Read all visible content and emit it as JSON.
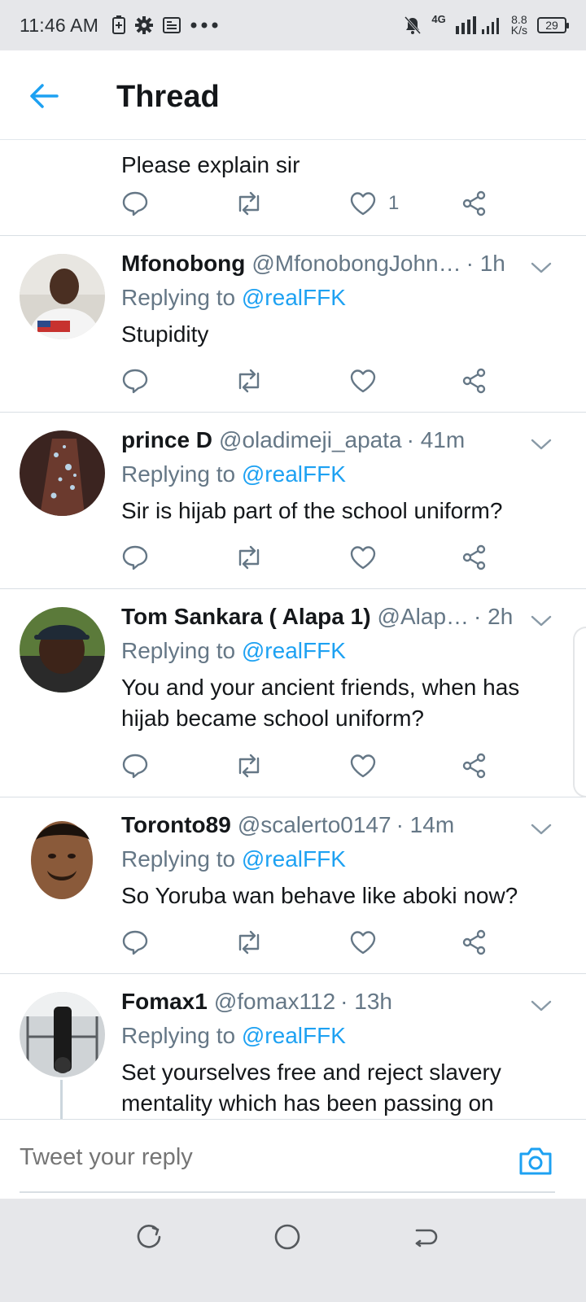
{
  "status_bar": {
    "time": "11:46 AM",
    "network": "4G",
    "speed_value": "8.8",
    "speed_unit": "K/s",
    "battery": "29"
  },
  "header": {
    "title": "Thread"
  },
  "tweets": [
    {
      "body": "Please explain sir",
      "like_count": "1"
    },
    {
      "name": "Mfonobong",
      "handle": "@MfonobongJohn…",
      "time": "· 1h",
      "replying_prefix": "Replying to",
      "replying_to": "@realFFK",
      "body": "Stupidity"
    },
    {
      "name": "prince D",
      "handle": "@oladimeji_apata",
      "time": "· 41m",
      "replying_prefix": "Replying to",
      "replying_to": "@realFFK",
      "body": "Sir is hijab part of the school uniform?"
    },
    {
      "name": "Tom Sankara ( Alapa 1)",
      "handle": "@Alap…",
      "time": "· 2h",
      "replying_prefix": "Replying to",
      "replying_to": "@realFFK",
      "body": "You and your ancient friends,  when has hijab became school uniform?"
    },
    {
      "name": "Toronto89",
      "handle": "@scalerto0147",
      "time": "· 14m",
      "replying_prefix": "Replying to",
      "replying_to": "@realFFK",
      "body": "So Yoruba wan behave like aboki now?"
    },
    {
      "name": "Fomax1",
      "handle": "@fomax112",
      "time": "· 13h",
      "replying_prefix": "Replying to",
      "replying_to": "@realFFK",
      "body": "Set yourselves free and reject slavery mentality which has been passing on"
    }
  ],
  "reply_bar": {
    "placeholder": "Tweet your reply"
  },
  "colors": {
    "accent": "#1da1f2",
    "muted": "#657786",
    "text": "#14171a",
    "divider": "#d9dfe4"
  },
  "icons": {
    "back": "arrow-left-icon",
    "reply": "reply-bubble-icon",
    "retweet": "retweet-icon",
    "like": "heart-icon",
    "share": "share-icon",
    "more": "chevron-down-icon",
    "camera": "camera-icon"
  }
}
